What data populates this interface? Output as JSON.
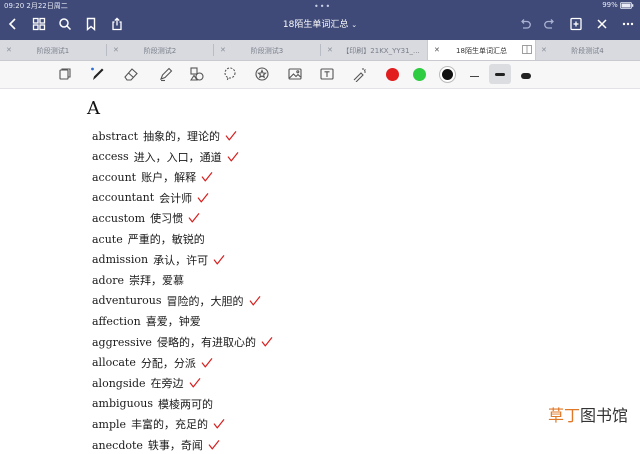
{
  "status": {
    "time_date": "09:20  2月22日周二",
    "battery": "99%"
  },
  "document": {
    "title": "18陌生单词汇总"
  },
  "tabs": [
    {
      "label": "阶段测试1",
      "active": false
    },
    {
      "label": "阶段测试2",
      "active": false
    },
    {
      "label": "阶段测试3",
      "active": false
    },
    {
      "label": "【印刷】21KX_YY31_...",
      "active": false
    },
    {
      "label": "18陌生单词汇总",
      "active": true
    },
    {
      "label": "阶段测试4",
      "active": false
    }
  ],
  "toolbar": {
    "tools": [
      "page-icon",
      "pen-icon",
      "eraser-icon",
      "highlighter-icon",
      "shapes-icon",
      "lasso-icon",
      "sticker-icon",
      "image-icon",
      "textbox-icon",
      "laser-icon"
    ],
    "colors": [
      "#e11d1d",
      "#2ecc40",
      "#111111"
    ],
    "selected_color": "#111111",
    "strokes": [
      "thin",
      "medium",
      "thick"
    ],
    "selected_stroke": "medium"
  },
  "content": {
    "heading": "A",
    "check_color": "#d62020",
    "words": [
      {
        "en": "abstract",
        "zh": "抽象的，理论的",
        "checked": true
      },
      {
        "en": "access",
        "zh": "进入，入口，通道",
        "checked": true
      },
      {
        "en": "account",
        "zh": "账户，解释",
        "checked": true
      },
      {
        "en": "accountant",
        "zh": "会计师",
        "checked": true
      },
      {
        "en": "accustom",
        "zh": "使习惯",
        "checked": true
      },
      {
        "en": "acute",
        "zh": "严重的，敏锐的",
        "checked": false
      },
      {
        "en": "admission",
        "zh": "承认，许可",
        "checked": true
      },
      {
        "en": "adore",
        "zh": "崇拜，爱慕",
        "checked": false
      },
      {
        "en": "adventurous",
        "zh": "冒险的，大胆的",
        "checked": true
      },
      {
        "en": "affection",
        "zh": "喜爱，钟爱",
        "checked": false
      },
      {
        "en": "aggressive",
        "zh": "侵略的，有进取心的",
        "checked": true
      },
      {
        "en": "allocate",
        "zh": "分配，分派",
        "checked": true
      },
      {
        "en": "alongside",
        "zh": "在旁边",
        "checked": true
      },
      {
        "en": "ambiguous",
        "zh": "模棱两可的",
        "checked": false
      },
      {
        "en": "ample",
        "zh": "丰富的，充足的",
        "checked": true
      },
      {
        "en": "anecdote",
        "zh": "轶事，奇闻",
        "checked": true
      }
    ]
  },
  "watermark": {
    "part1": "草丁",
    "part2": "图书馆"
  }
}
